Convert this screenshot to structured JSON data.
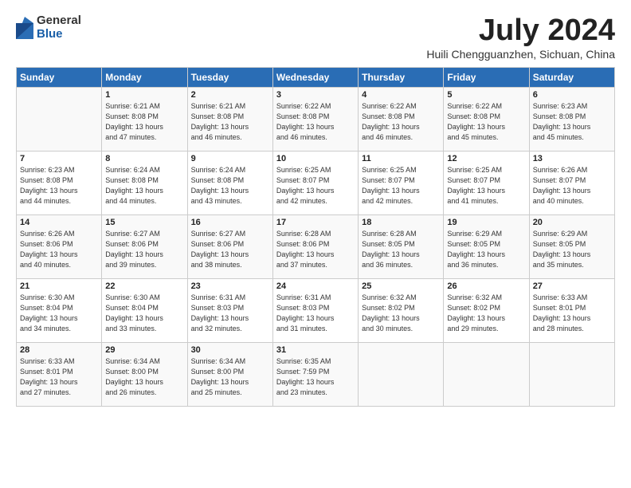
{
  "logo": {
    "general": "General",
    "blue": "Blue"
  },
  "title": "July 2024",
  "subtitle": "Huili Chengguanzhen, Sichuan, China",
  "headers": [
    "Sunday",
    "Monday",
    "Tuesday",
    "Wednesday",
    "Thursday",
    "Friday",
    "Saturday"
  ],
  "weeks": [
    [
      {
        "day": "",
        "info": ""
      },
      {
        "day": "1",
        "info": "Sunrise: 6:21 AM\nSunset: 8:08 PM\nDaylight: 13 hours\nand 47 minutes."
      },
      {
        "day": "2",
        "info": "Sunrise: 6:21 AM\nSunset: 8:08 PM\nDaylight: 13 hours\nand 46 minutes."
      },
      {
        "day": "3",
        "info": "Sunrise: 6:22 AM\nSunset: 8:08 PM\nDaylight: 13 hours\nand 46 minutes."
      },
      {
        "day": "4",
        "info": "Sunrise: 6:22 AM\nSunset: 8:08 PM\nDaylight: 13 hours\nand 46 minutes."
      },
      {
        "day": "5",
        "info": "Sunrise: 6:22 AM\nSunset: 8:08 PM\nDaylight: 13 hours\nand 45 minutes."
      },
      {
        "day": "6",
        "info": "Sunrise: 6:23 AM\nSunset: 8:08 PM\nDaylight: 13 hours\nand 45 minutes."
      }
    ],
    [
      {
        "day": "7",
        "info": "Sunrise: 6:23 AM\nSunset: 8:08 PM\nDaylight: 13 hours\nand 44 minutes."
      },
      {
        "day": "8",
        "info": "Sunrise: 6:24 AM\nSunset: 8:08 PM\nDaylight: 13 hours\nand 44 minutes."
      },
      {
        "day": "9",
        "info": "Sunrise: 6:24 AM\nSunset: 8:08 PM\nDaylight: 13 hours\nand 43 minutes."
      },
      {
        "day": "10",
        "info": "Sunrise: 6:25 AM\nSunset: 8:07 PM\nDaylight: 13 hours\nand 42 minutes."
      },
      {
        "day": "11",
        "info": "Sunrise: 6:25 AM\nSunset: 8:07 PM\nDaylight: 13 hours\nand 42 minutes."
      },
      {
        "day": "12",
        "info": "Sunrise: 6:25 AM\nSunset: 8:07 PM\nDaylight: 13 hours\nand 41 minutes."
      },
      {
        "day": "13",
        "info": "Sunrise: 6:26 AM\nSunset: 8:07 PM\nDaylight: 13 hours\nand 40 minutes."
      }
    ],
    [
      {
        "day": "14",
        "info": "Sunrise: 6:26 AM\nSunset: 8:06 PM\nDaylight: 13 hours\nand 40 minutes."
      },
      {
        "day": "15",
        "info": "Sunrise: 6:27 AM\nSunset: 8:06 PM\nDaylight: 13 hours\nand 39 minutes."
      },
      {
        "day": "16",
        "info": "Sunrise: 6:27 AM\nSunset: 8:06 PM\nDaylight: 13 hours\nand 38 minutes."
      },
      {
        "day": "17",
        "info": "Sunrise: 6:28 AM\nSunset: 8:06 PM\nDaylight: 13 hours\nand 37 minutes."
      },
      {
        "day": "18",
        "info": "Sunrise: 6:28 AM\nSunset: 8:05 PM\nDaylight: 13 hours\nand 36 minutes."
      },
      {
        "day": "19",
        "info": "Sunrise: 6:29 AM\nSunset: 8:05 PM\nDaylight: 13 hours\nand 36 minutes."
      },
      {
        "day": "20",
        "info": "Sunrise: 6:29 AM\nSunset: 8:05 PM\nDaylight: 13 hours\nand 35 minutes."
      }
    ],
    [
      {
        "day": "21",
        "info": "Sunrise: 6:30 AM\nSunset: 8:04 PM\nDaylight: 13 hours\nand 34 minutes."
      },
      {
        "day": "22",
        "info": "Sunrise: 6:30 AM\nSunset: 8:04 PM\nDaylight: 13 hours\nand 33 minutes."
      },
      {
        "day": "23",
        "info": "Sunrise: 6:31 AM\nSunset: 8:03 PM\nDaylight: 13 hours\nand 32 minutes."
      },
      {
        "day": "24",
        "info": "Sunrise: 6:31 AM\nSunset: 8:03 PM\nDaylight: 13 hours\nand 31 minutes."
      },
      {
        "day": "25",
        "info": "Sunrise: 6:32 AM\nSunset: 8:02 PM\nDaylight: 13 hours\nand 30 minutes."
      },
      {
        "day": "26",
        "info": "Sunrise: 6:32 AM\nSunset: 8:02 PM\nDaylight: 13 hours\nand 29 minutes."
      },
      {
        "day": "27",
        "info": "Sunrise: 6:33 AM\nSunset: 8:01 PM\nDaylight: 13 hours\nand 28 minutes."
      }
    ],
    [
      {
        "day": "28",
        "info": "Sunrise: 6:33 AM\nSunset: 8:01 PM\nDaylight: 13 hours\nand 27 minutes."
      },
      {
        "day": "29",
        "info": "Sunrise: 6:34 AM\nSunset: 8:00 PM\nDaylight: 13 hours\nand 26 minutes."
      },
      {
        "day": "30",
        "info": "Sunrise: 6:34 AM\nSunset: 8:00 PM\nDaylight: 13 hours\nand 25 minutes."
      },
      {
        "day": "31",
        "info": "Sunrise: 6:35 AM\nSunset: 7:59 PM\nDaylight: 13 hours\nand 23 minutes."
      },
      {
        "day": "",
        "info": ""
      },
      {
        "day": "",
        "info": ""
      },
      {
        "day": "",
        "info": ""
      }
    ]
  ]
}
